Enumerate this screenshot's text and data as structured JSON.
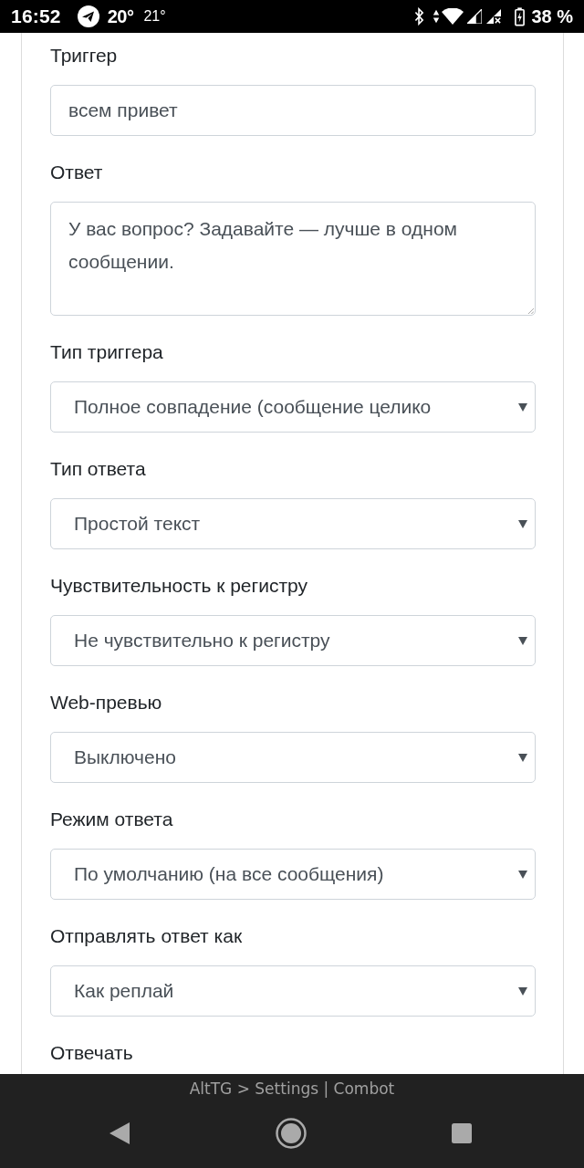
{
  "status_bar": {
    "time": "16:52",
    "temperature": "20°",
    "temperature_2": "21°",
    "battery": "38 %"
  },
  "form": {
    "fields": [
      {
        "kind": "text",
        "label": "Триггер",
        "value": "всем привет"
      },
      {
        "kind": "textarea",
        "label": "Ответ",
        "value": "У вас вопрос? Задавайте — лучше в одном сообщении."
      },
      {
        "kind": "select",
        "label": "Тип триггера",
        "value": "Полное совпадение (сообщение целико"
      },
      {
        "kind": "select",
        "label": "Тип ответа",
        "value": "Простой текст"
      },
      {
        "kind": "select",
        "label": "Чувствительность к регистру",
        "value": "Не чувствительно к регистру"
      },
      {
        "kind": "select",
        "label": "Web-превью",
        "value": "Выключено"
      },
      {
        "kind": "select",
        "label": "Режим ответа",
        "value": "По умолчанию (на все сообщения)"
      },
      {
        "kind": "select",
        "label": "Отправлять ответ как",
        "value": "Как реплай"
      },
      {
        "kind": "label",
        "label": "Отвечать"
      }
    ]
  },
  "footer": {
    "title": "AltTG > Settings | Combot"
  }
}
